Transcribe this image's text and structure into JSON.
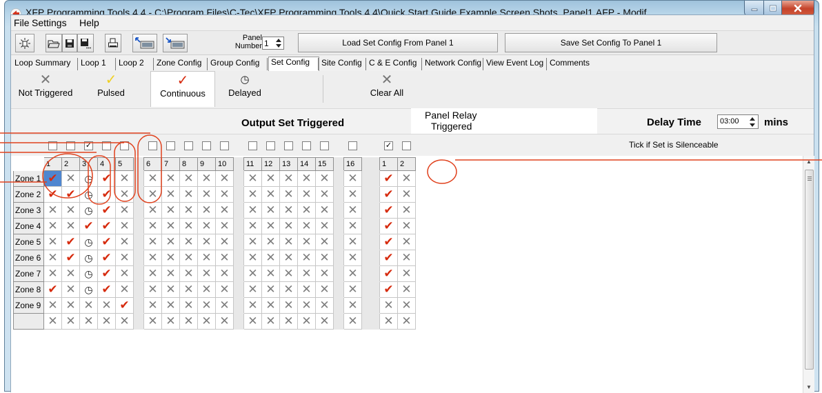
{
  "window": {
    "title": "XFP Programming Tools 4.4 - C:\\Program Files\\C-Tec\\XFP Programming Tools 4.4\\Quick Start Guide Example Screen Shots_Panel1.AFP - Modif...",
    "minimize_label": "–",
    "maximize_label": "▫",
    "close_label": "✕"
  },
  "menubar": {
    "items": [
      "File",
      "Settings",
      "Help"
    ]
  },
  "toolbar": {
    "panel_label_line1": "Panel",
    "panel_label_line2": "Number",
    "panel_number": "1",
    "load_label": "Load Set Config From Panel 1",
    "save_label": "Save Set Config To Panel 1"
  },
  "tabs": [
    "Loop Summary",
    "Loop 1",
    "Loop 2",
    "Zone Config",
    "Group Config",
    "Set Config",
    "Site Config",
    "C & E Config",
    "Network Config",
    "View Event Log",
    "Comments"
  ],
  "active_tab": "Set Config",
  "modes": {
    "not_triggered": {
      "label": "Not Triggered",
      "glyph": "✕"
    },
    "pulsed": {
      "label": "Pulsed",
      "glyph": "✓"
    },
    "continuous": {
      "label": "Continuous",
      "glyph": "✓"
    },
    "delayed": {
      "label": "Delayed",
      "glyph": "◷"
    },
    "clear_all": {
      "label": "Clear All",
      "glyph": "✕"
    }
  },
  "headers": {
    "output_set": "Output Set Triggered",
    "panel_relay_line1": "Panel Relay",
    "panel_relay_line2": "Triggered",
    "delay_label": "Delay Time",
    "delay_value": "03:00",
    "delay_unit": "mins",
    "silenceable": "Tick if Set is Silenceable"
  },
  "silenceable": {
    "output_sets": [
      false,
      false,
      true,
      false,
      false,
      false,
      false,
      false,
      false,
      false,
      false,
      false,
      false,
      false,
      false,
      false
    ],
    "relays": [
      true,
      false
    ]
  },
  "columns": {
    "output_sets": [
      "1",
      "2",
      "3",
      "4",
      "5",
      "6",
      "7",
      "8",
      "9",
      "10",
      "11",
      "12",
      "13",
      "14",
      "15",
      "16"
    ],
    "relays": [
      "1",
      "2"
    ]
  },
  "rows": [
    {
      "zone": "Zone 1",
      "sets": [
        "T",
        "X",
        "D",
        "T",
        "X",
        "X",
        "X",
        "X",
        "X",
        "X",
        "X",
        "X",
        "X",
        "X",
        "X",
        "X"
      ],
      "relays": [
        "T",
        "X"
      ]
    },
    {
      "zone": "Zone 2",
      "sets": [
        "T",
        "T",
        "D",
        "T",
        "X",
        "X",
        "X",
        "X",
        "X",
        "X",
        "X",
        "X",
        "X",
        "X",
        "X",
        "X"
      ],
      "relays": [
        "T",
        "X"
      ]
    },
    {
      "zone": "Zone 3",
      "sets": [
        "X",
        "X",
        "D",
        "T",
        "X",
        "X",
        "X",
        "X",
        "X",
        "X",
        "X",
        "X",
        "X",
        "X",
        "X",
        "X"
      ],
      "relays": [
        "T",
        "X"
      ]
    },
    {
      "zone": "Zone 4",
      "sets": [
        "X",
        "X",
        "T",
        "T",
        "X",
        "X",
        "X",
        "X",
        "X",
        "X",
        "X",
        "X",
        "X",
        "X",
        "X",
        "X"
      ],
      "relays": [
        "T",
        "X"
      ]
    },
    {
      "zone": "Zone 5",
      "sets": [
        "X",
        "T",
        "D",
        "T",
        "X",
        "X",
        "X",
        "X",
        "X",
        "X",
        "X",
        "X",
        "X",
        "X",
        "X",
        "X"
      ],
      "relays": [
        "T",
        "X"
      ]
    },
    {
      "zone": "Zone 6",
      "sets": [
        "X",
        "T",
        "D",
        "T",
        "X",
        "X",
        "X",
        "X",
        "X",
        "X",
        "X",
        "X",
        "X",
        "X",
        "X",
        "X"
      ],
      "relays": [
        "T",
        "X"
      ]
    },
    {
      "zone": "Zone 7",
      "sets": [
        "X",
        "X",
        "D",
        "T",
        "X",
        "X",
        "X",
        "X",
        "X",
        "X",
        "X",
        "X",
        "X",
        "X",
        "X",
        "X"
      ],
      "relays": [
        "T",
        "X"
      ]
    },
    {
      "zone": "Zone 8",
      "sets": [
        "T",
        "X",
        "D",
        "T",
        "X",
        "X",
        "X",
        "X",
        "X",
        "X",
        "X",
        "X",
        "X",
        "X",
        "X",
        "X"
      ],
      "relays": [
        "T",
        "X"
      ]
    },
    {
      "zone": "Zone 9",
      "sets": [
        "X",
        "X",
        "X",
        "X",
        "T",
        "X",
        "X",
        "X",
        "X",
        "X",
        "X",
        "X",
        "X",
        "X",
        "X",
        "X"
      ],
      "relays": [
        "X",
        "X"
      ]
    },
    {
      "zone": "",
      "sets": [
        "X",
        "X",
        "X",
        "X",
        "X",
        "X",
        "X",
        "X",
        "X",
        "X",
        "X",
        "X",
        "X",
        "X",
        "X",
        "X"
      ],
      "relays": [
        "X",
        "X"
      ]
    }
  ],
  "selected_cell": {
    "row": 0,
    "col": 0
  },
  "colors": {
    "triggered": "#d62b0e",
    "not_triggered": "#7d7d7d",
    "annotation": "#e0401c"
  }
}
